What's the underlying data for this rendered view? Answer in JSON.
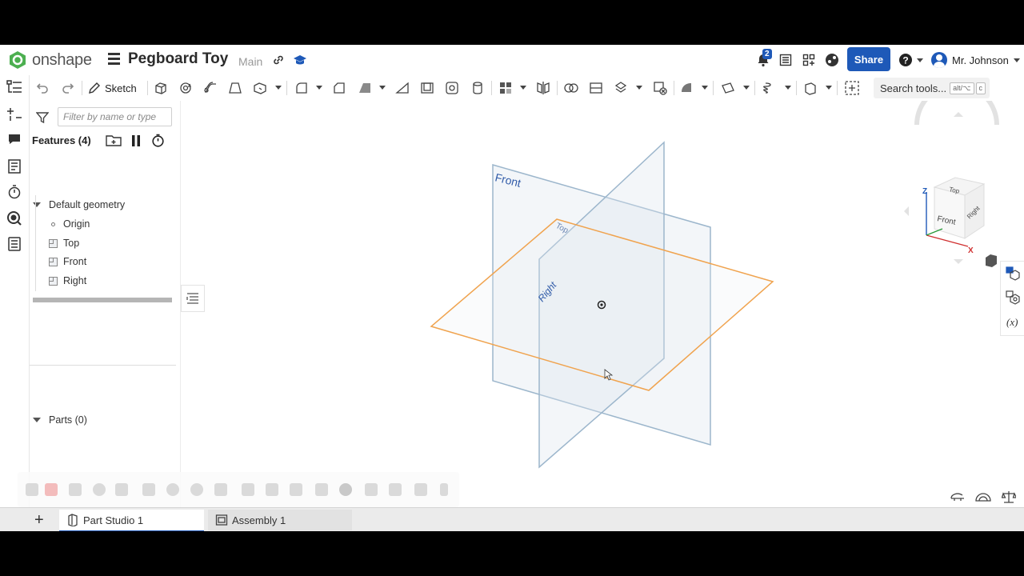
{
  "header": {
    "logo_text": "onshape",
    "doc_title": "Pegboard Toy",
    "branch": "Main",
    "notification_count": "2",
    "share_label": "Share",
    "user_name": "Mr. Johnson"
  },
  "toolbar": {
    "sketch_label": "Sketch",
    "search_label": "Search tools...",
    "search_shortcut_1": "alt/⌥",
    "search_shortcut_2": "c"
  },
  "feature_panel": {
    "filter_placeholder": "Filter by name or type",
    "features_heading": "Features (4)",
    "default_geometry_label": "Default geometry",
    "items": [
      {
        "label": "Origin"
      },
      {
        "label": "Top"
      },
      {
        "label": "Front"
      },
      {
        "label": "Right"
      }
    ],
    "parts_heading": "Parts (0)"
  },
  "viewport": {
    "plane_labels": {
      "front": "Front",
      "top": "Top",
      "right": "Right"
    },
    "view_cube": {
      "top": "Top",
      "front": "Front",
      "right": "Right",
      "axis_z": "Z",
      "axis_x": "X"
    },
    "colors": {
      "top_plane": "#f0a34e",
      "other_planes": "#9cb6cc",
      "plane_label": "#2f5aa8"
    }
  },
  "tabs": [
    {
      "label": "Part Studio 1",
      "active": true
    },
    {
      "label": "Assembly 1",
      "active": false
    }
  ],
  "colors": {
    "accent": "#1e59b8",
    "logo_green": "#4caf50"
  }
}
